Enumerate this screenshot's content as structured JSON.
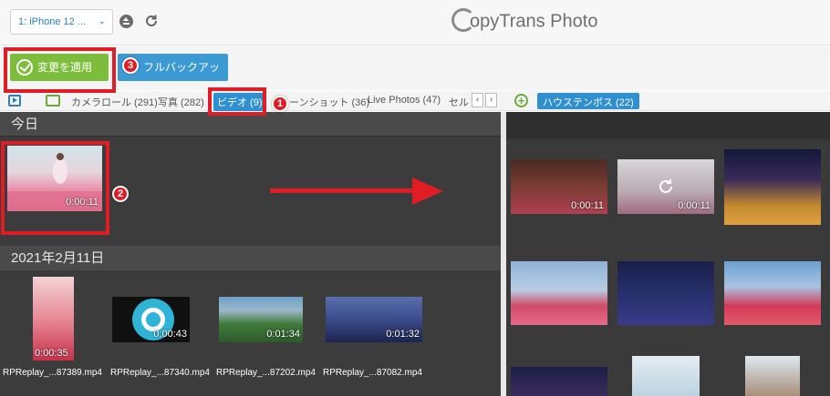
{
  "app": {
    "logo_text": "opyTrans Photo"
  },
  "header": {
    "device_label": "1: iPhone 12 ...",
    "eject_icon": "eject-icon",
    "refresh_icon": "refresh-icon"
  },
  "toolbar": {
    "apply_label": "変更を適用",
    "backup_label": "フルバックアップ"
  },
  "tabs": [
    {
      "label": "カメラロール (291)"
    },
    {
      "label": "写真 (282)"
    },
    {
      "label": "ビデオ (9)"
    },
    {
      "label": "ーンショット (36)"
    },
    {
      "label": "Live Photos (47)"
    },
    {
      "label": "セルフ"
    }
  ],
  "tab_scroll": {
    "left": "‹",
    "right": "›"
  },
  "album": {
    "label": "ハウステンボス (22)"
  },
  "left": {
    "today_header": "今日",
    "today_video": {
      "duration": "0:00:11"
    },
    "date_header": "2021年2月11日",
    "videos": [
      {
        "duration": "0:00:35",
        "filename": "RPReplay_...87389.mp4"
      },
      {
        "duration": "0:00:43",
        "filename": "RPReplay_...87340.mp4"
      },
      {
        "duration": "0:01:34",
        "filename": "RPReplay_...87202.mp4"
      },
      {
        "duration": "0:01:32",
        "filename": "RPReplay_...87082.mp4"
      }
    ]
  },
  "right": {
    "items": [
      {
        "duration": "0:00:11"
      },
      {
        "duration": "0:00:11"
      }
    ]
  },
  "annotations": {
    "badge1": "1",
    "badge2": "2",
    "badge3": "3"
  },
  "colors": {
    "accent_blue": "#2f8fd0",
    "apply_green": "#7cbe3c",
    "annotation_red": "#e01c24",
    "pane_dark": "#3c3c3c"
  }
}
